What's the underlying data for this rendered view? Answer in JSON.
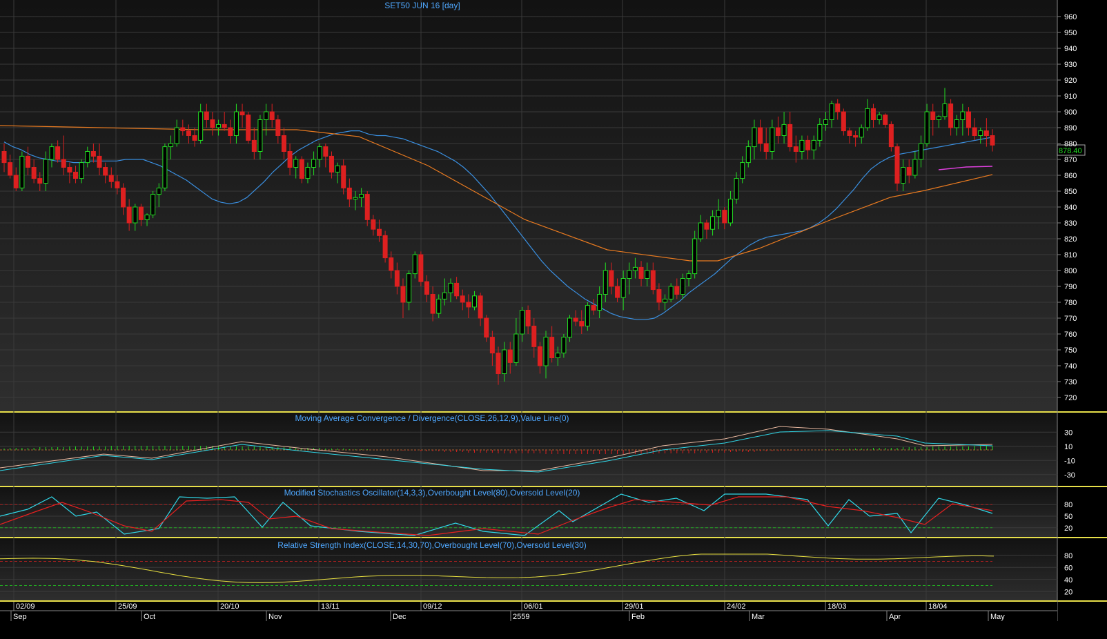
{
  "colors": {
    "background": "#000000",
    "panel_top": "#141414",
    "panel_bottom": "#2c2c2c",
    "grid": "#3a3a3a",
    "panel_border": "#e8e04a",
    "axis_text": "#ffffff",
    "title_text": "#4fa8ff",
    "up_candle": "#22dd22",
    "down_candle": "#dd2020",
    "ma_fast": "#3a8fe0",
    "ma_slow": "#e87a20",
    "ma_pink": "#e040e0",
    "macd_line": "#e8b8a0",
    "macd_signal": "#30d8e8",
    "stoch_k": "#30d8e8",
    "stoch_d": "#e82020",
    "rsi_line": "#e8e040",
    "ob_level": "#aa2020",
    "os_level": "#22aa22"
  },
  "chart_data": [
    {
      "type": "candlestick",
      "title": "SET50 JUN 16  [day]",
      "last_price_label": "878.40",
      "y_ticks": [
        "960",
        "950",
        "940",
        "930",
        "920",
        "910",
        "900",
        "890",
        "880",
        "870",
        "860",
        "850",
        "840",
        "830",
        "820",
        "810",
        "800",
        "790",
        "780",
        "770",
        "760",
        "750",
        "740",
        "730",
        "720"
      ],
      "ylim": [
        720,
        960
      ],
      "candles": [
        [
          875,
          880,
          862,
          868
        ],
        [
          868,
          873,
          858,
          860
        ],
        [
          860,
          865,
          850,
          852
        ],
        [
          852,
          875,
          850,
          872
        ],
        [
          872,
          878,
          860,
          865
        ],
        [
          865,
          870,
          855,
          858
        ],
        [
          858,
          862,
          850,
          855
        ],
        [
          855,
          875,
          850,
          870
        ],
        [
          870,
          880,
          865,
          878
        ],
        [
          878,
          882,
          868,
          870
        ],
        [
          870,
          885,
          860,
          865
        ],
        [
          865,
          868,
          855,
          862
        ],
        [
          862,
          866,
          855,
          858
        ],
        [
          858,
          870,
          855,
          868
        ],
        [
          868,
          878,
          865,
          875
        ],
        [
          875,
          880,
          868,
          872
        ],
        [
          872,
          880,
          860,
          865
        ],
        [
          865,
          868,
          855,
          860
        ],
        [
          860,
          865,
          852,
          856
        ],
        [
          856,
          860,
          848,
          852
        ],
        [
          852,
          855,
          835,
          840
        ],
        [
          840,
          845,
          825,
          830
        ],
        [
          830,
          842,
          825,
          840
        ],
        [
          840,
          842,
          828,
          832
        ],
        [
          832,
          836,
          828,
          835
        ],
        [
          835,
          850,
          833,
          848
        ],
        [
          848,
          855,
          840,
          852
        ],
        [
          852,
          880,
          850,
          878
        ],
        [
          878,
          885,
          870,
          880
        ],
        [
          880,
          895,
          878,
          890
        ],
        [
          890,
          895,
          885,
          888
        ],
        [
          888,
          892,
          880,
          885
        ],
        [
          885,
          890,
          878,
          882
        ],
        [
          882,
          905,
          880,
          900
        ],
        [
          900,
          905,
          890,
          895
        ],
        [
          895,
          900,
          885,
          890
        ],
        [
          890,
          895,
          885,
          892
        ],
        [
          892,
          900,
          888,
          890
        ],
        [
          890,
          895,
          880,
          885
        ],
        [
          885,
          905,
          880,
          900
        ],
        [
          900,
          905,
          890,
          898
        ],
        [
          898,
          900,
          880,
          882
        ],
        [
          882,
          890,
          870,
          875
        ],
        [
          875,
          898,
          870,
          895
        ],
        [
          895,
          905,
          885,
          900
        ],
        [
          900,
          905,
          890,
          895
        ],
        [
          895,
          898,
          880,
          885
        ],
        [
          885,
          890,
          870,
          875
        ],
        [
          875,
          880,
          860,
          865
        ],
        [
          865,
          872,
          858,
          870
        ],
        [
          870,
          872,
          855,
          858
        ],
        [
          858,
          868,
          855,
          865
        ],
        [
          865,
          875,
          860,
          870
        ],
        [
          870,
          880,
          865,
          878
        ],
        [
          878,
          880,
          865,
          872
        ],
        [
          872,
          875,
          858,
          862
        ],
        [
          862,
          868,
          855,
          866
        ],
        [
          866,
          870,
          848,
          852
        ],
        [
          852,
          858,
          840,
          845
        ],
        [
          845,
          850,
          838,
          846
        ],
        [
          846,
          852,
          840,
          848
        ],
        [
          848,
          850,
          828,
          832
        ],
        [
          832,
          835,
          822,
          826
        ],
        [
          826,
          832,
          818,
          822
        ],
        [
          822,
          825,
          805,
          808
        ],
        [
          808,
          812,
          795,
          800
        ],
        [
          800,
          805,
          785,
          790
        ],
        [
          790,
          795,
          770,
          780
        ],
        [
          780,
          800,
          775,
          798
        ],
        [
          798,
          812,
          795,
          810
        ],
        [
          810,
          812,
          790,
          793
        ],
        [
          793,
          797,
          780,
          785
        ],
        [
          785,
          790,
          768,
          773
        ],
        [
          773,
          785,
          770,
          782
        ],
        [
          782,
          795,
          778,
          786
        ],
        [
          786,
          795,
          780,
          792
        ],
        [
          792,
          796,
          782,
          784
        ],
        [
          784,
          788,
          775,
          780
        ],
        [
          780,
          785,
          770,
          777
        ],
        [
          777,
          787,
          775,
          784
        ],
        [
          784,
          786,
          765,
          770
        ],
        [
          770,
          772,
          755,
          758
        ],
        [
          758,
          762,
          740,
          748
        ],
        [
          748,
          752,
          728,
          735
        ],
        [
          735,
          755,
          730,
          750
        ],
        [
          750,
          755,
          735,
          742
        ],
        [
          742,
          770,
          740,
          760
        ],
        [
          760,
          777,
          755,
          775
        ],
        [
          775,
          778,
          760,
          765
        ],
        [
          765,
          770,
          745,
          752
        ],
        [
          752,
          755,
          735,
          740
        ],
        [
          740,
          762,
          732,
          758
        ],
        [
          758,
          765,
          742,
          745
        ],
        [
          745,
          752,
          740,
          748
        ],
        [
          748,
          760,
          745,
          758
        ],
        [
          758,
          772,
          755,
          770
        ],
        [
          770,
          775,
          765,
          768
        ],
        [
          768,
          775,
          760,
          765
        ],
        [
          765,
          780,
          762,
          778
        ],
        [
          778,
          782,
          772,
          775
        ],
        [
          775,
          790,
          770,
          785
        ],
        [
          785,
          805,
          780,
          800
        ],
        [
          800,
          805,
          785,
          790
        ],
        [
          790,
          795,
          780,
          783
        ],
        [
          783,
          800,
          775,
          795
        ],
        [
          795,
          805,
          785,
          800
        ],
        [
          800,
          808,
          795,
          802
        ],
        [
          802,
          806,
          790,
          795
        ],
        [
          795,
          805,
          790,
          800
        ],
        [
          800,
          805,
          785,
          788
        ],
        [
          788,
          792,
          775,
          780
        ],
        [
          780,
          785,
          775,
          782
        ],
        [
          782,
          792,
          780,
          790
        ],
        [
          790,
          795,
          782,
          785
        ],
        [
          785,
          798,
          782,
          795
        ],
        [
          795,
          800,
          790,
          798
        ],
        [
          798,
          825,
          795,
          820
        ],
        [
          820,
          835,
          818,
          830
        ],
        [
          830,
          832,
          820,
          826
        ],
        [
          826,
          838,
          822,
          834
        ],
        [
          834,
          845,
          826,
          838
        ],
        [
          838,
          840,
          826,
          830
        ],
        [
          830,
          850,
          828,
          845
        ],
        [
          845,
          862,
          842,
          858
        ],
        [
          858,
          872,
          855,
          868
        ],
        [
          868,
          882,
          865,
          878
        ],
        [
          878,
          895,
          870,
          890
        ],
        [
          890,
          895,
          875,
          880
        ],
        [
          880,
          890,
          870,
          875
        ],
        [
          875,
          895,
          870,
          890
        ],
        [
          890,
          897,
          880,
          885
        ],
        [
          885,
          900,
          880,
          892
        ],
        [
          892,
          900,
          875,
          878
        ],
        [
          878,
          885,
          868,
          875
        ],
        [
          875,
          885,
          870,
          882
        ],
        [
          882,
          885,
          870,
          876
        ],
        [
          876,
          885,
          870,
          882
        ],
        [
          882,
          896,
          878,
          892
        ],
        [
          892,
          900,
          888,
          895
        ],
        [
          895,
          907,
          890,
          905
        ],
        [
          905,
          908,
          895,
          900
        ],
        [
          900,
          902,
          885,
          888
        ],
        [
          888,
          890,
          880,
          885
        ],
        [
          885,
          888,
          878,
          884
        ],
        [
          884,
          892,
          880,
          890
        ],
        [
          890,
          908,
          888,
          902
        ],
        [
          902,
          905,
          890,
          895
        ],
        [
          895,
          900,
          892,
          898
        ],
        [
          898,
          899,
          890,
          892
        ],
        [
          892,
          894,
          875,
          878
        ],
        [
          878,
          880,
          850,
          855
        ],
        [
          855,
          870,
          850,
          865
        ],
        [
          865,
          870,
          855,
          860
        ],
        [
          860,
          875,
          858,
          870
        ],
        [
          870,
          885,
          865,
          880
        ],
        [
          880,
          905,
          878,
          900
        ],
        [
          900,
          905,
          885,
          895
        ],
        [
          895,
          898,
          890,
          897
        ],
        [
          897,
          915,
          895,
          905
        ],
        [
          905,
          908,
          885,
          890
        ],
        [
          890,
          898,
          885,
          895
        ],
        [
          895,
          905,
          885,
          900
        ],
        [
          900,
          903,
          885,
          890
        ],
        [
          890,
          896,
          882,
          885
        ],
        [
          885,
          890,
          880,
          888
        ],
        [
          888,
          896,
          878,
          885
        ],
        [
          885,
          889,
          875,
          879
        ]
      ],
      "moving_averages": [
        {
          "name": "",
          "color_key": "ma_fast",
          "values": [
            881,
            878,
            876,
            873,
            871,
            870,
            869,
            869,
            868,
            868,
            869,
            869,
            869,
            869,
            870,
            870,
            870,
            868,
            866,
            863,
            860,
            857,
            853,
            849,
            845,
            843,
            842,
            843,
            846,
            851,
            856,
            862,
            867,
            872,
            876,
            879,
            882,
            884,
            886,
            887,
            888,
            888,
            886,
            885,
            885,
            884,
            883,
            881,
            879,
            877,
            875,
            872,
            869,
            865,
            860,
            854,
            848,
            841,
            834,
            827,
            820,
            813,
            806,
            800,
            795,
            790,
            786,
            782,
            779,
            776,
            773,
            771,
            770,
            769,
            769,
            770,
            773,
            777,
            781,
            786,
            790,
            794,
            798,
            803,
            808,
            812,
            816,
            819,
            821,
            822,
            823,
            824,
            825,
            827,
            830,
            834,
            839,
            845,
            851,
            858,
            864,
            868,
            871,
            873,
            874,
            875,
            876,
            877,
            878,
            879,
            880,
            881,
            882,
            883,
            884
          ]
        }
      ],
      "ma_note_series": [
        {
          "name": "",
          "color_key": "ma_slow"
        },
        {
          "name": "",
          "color_key": "ma_pink"
        }
      ]
    },
    {
      "type": "indicator",
      "title": "Moving Average Convergence / Divergence(CLOSE,26,12,9),Value Line(0)",
      "y_ticks": [
        "30",
        "10",
        "-10",
        "-30"
      ],
      "ylim": [
        -40,
        40
      ]
    },
    {
      "type": "indicator",
      "title": "Modified Stochastics Oscillator(14,3,3),Overbought Level(80),Oversold Level(20)",
      "y_ticks": [
        "80",
        "50",
        "20"
      ],
      "ylim": [
        0,
        100
      ],
      "overbought": 80,
      "oversold": 20
    },
    {
      "type": "indicator",
      "title": "Relative Strength Index(CLOSE,14,30,70),Overbought Level(70),Oversold Level(30)",
      "y_ticks": [
        "80",
        "60",
        "40",
        "20"
      ],
      "ylim": [
        10,
        90
      ],
      "overbought": 70,
      "oversold": 30
    }
  ],
  "x_axis": {
    "upper_labels": [
      "02/09",
      "25/09",
      "20/10",
      "13/11",
      "09/12",
      "06/01",
      "29/01",
      "24/02",
      "18/03",
      "18/04"
    ],
    "lower_labels": [
      "Sep",
      "Oct",
      "Nov",
      "Dec",
      "2559",
      "Feb",
      "Mar",
      "Apr",
      "May"
    ]
  }
}
